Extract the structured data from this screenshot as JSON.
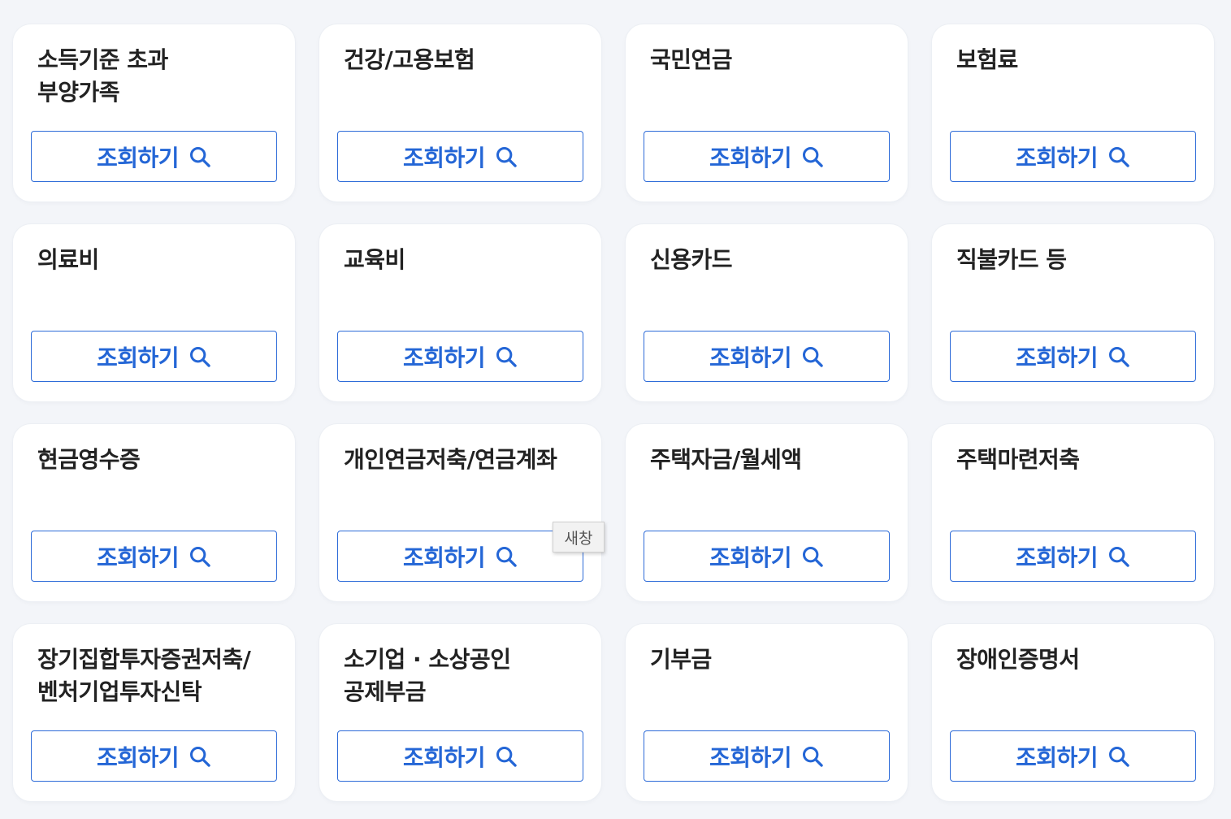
{
  "cards": [
    {
      "title": "소득기준 초과\n부양가족",
      "button_label": "조회하기"
    },
    {
      "title": "건강/고용보험",
      "button_label": "조회하기"
    },
    {
      "title": "국민연금",
      "button_label": "조회하기"
    },
    {
      "title": "보험료",
      "button_label": "조회하기"
    },
    {
      "title": "의료비",
      "button_label": "조회하기"
    },
    {
      "title": "교육비",
      "button_label": "조회하기"
    },
    {
      "title": "신용카드",
      "button_label": "조회하기"
    },
    {
      "title": "직불카드 등",
      "button_label": "조회하기"
    },
    {
      "title": "현금영수증",
      "button_label": "조회하기"
    },
    {
      "title": "개인연금저축/연금계좌",
      "button_label": "조회하기"
    },
    {
      "title": "주택자금/월세액",
      "button_label": "조회하기"
    },
    {
      "title": "주택마련저축",
      "button_label": "조회하기"
    },
    {
      "title": "장기집합투자증권저축/\n벤처기업투자신탁",
      "button_label": "조회하기"
    },
    {
      "title": "소기업 · 소상공인\n공제부금",
      "button_label": "조회하기"
    },
    {
      "title": "기부금",
      "button_label": "조회하기"
    },
    {
      "title": "장애인증명서",
      "button_label": "조회하기"
    }
  ],
  "tooltip": {
    "text": "새창"
  },
  "button_icon": "search-icon",
  "colors": {
    "accent": "#2466d6",
    "background": "#f3f5f9",
    "card": "#ffffff",
    "title": "#222222"
  }
}
